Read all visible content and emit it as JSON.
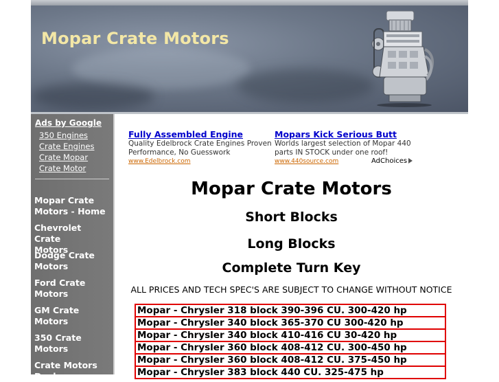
{
  "header": {
    "site_title": "Mopar Crate Motors",
    "image": "engine-image"
  },
  "sidebar": {
    "ads_title": "Ads by Google",
    "ad_links": [
      "350 Engines",
      "Crate Engines",
      "Crate Mopar",
      "Crate Motor"
    ],
    "nav": [
      {
        "line1": "Mopar Crate",
        "line2": "Motors - Home"
      },
      {
        "line1": "Chevrolet Crate",
        "line2": "Motors"
      },
      {
        "line1": "Dodge Crate",
        "line2": "Motors"
      },
      {
        "line1": "Ford Crate",
        "line2": "Motors"
      },
      {
        "line1": "GM Crate",
        "line2": "Motors"
      },
      {
        "line1": "350 Crate",
        "line2": "Motors"
      },
      {
        "line1": "Crate Motors",
        "line2": "Deals"
      }
    ]
  },
  "ads": [
    {
      "title": "Fully Assembled Engine",
      "text": "Quality Edelbrock Crate Engines Proven Performance, No Guesswork",
      "url": "www.Edelbrock.com"
    },
    {
      "title": "Mopars Kick Serious Butt",
      "text": "Worlds largest selection of Mopar 440 parts IN STOCK under one roof!",
      "url": "www.440source.com"
    }
  ],
  "adchoices_label": "AdChoices",
  "main": {
    "title": "Mopar Crate Motors",
    "sub1": "Short Blocks",
    "sub2": "Long Blocks",
    "sub3": "Complete Turn Key",
    "notice": "ALL PRICES AND TECH SPEC'S ARE SUBJECT TO CHANGE WITHOUT NOTICE"
  },
  "price_rows": [
    "Mopar - Chrysler 318 block 390-396 CU. 300-420 hp",
    "Mopar - Chrysler 340 block 365-370 CU 300-420 hp",
    "Mopar - Chrysler 340 block 410-416 CU 30-420 hp",
    "Mopar - Chrysler 360 block 408-412 CU. 300-450 hp",
    "Mopar - Chrysler 360 block 408-412 CU. 375-450 hp",
    "Mopar - Chrysler 383 block 440 CU. 325-475 hp"
  ]
}
